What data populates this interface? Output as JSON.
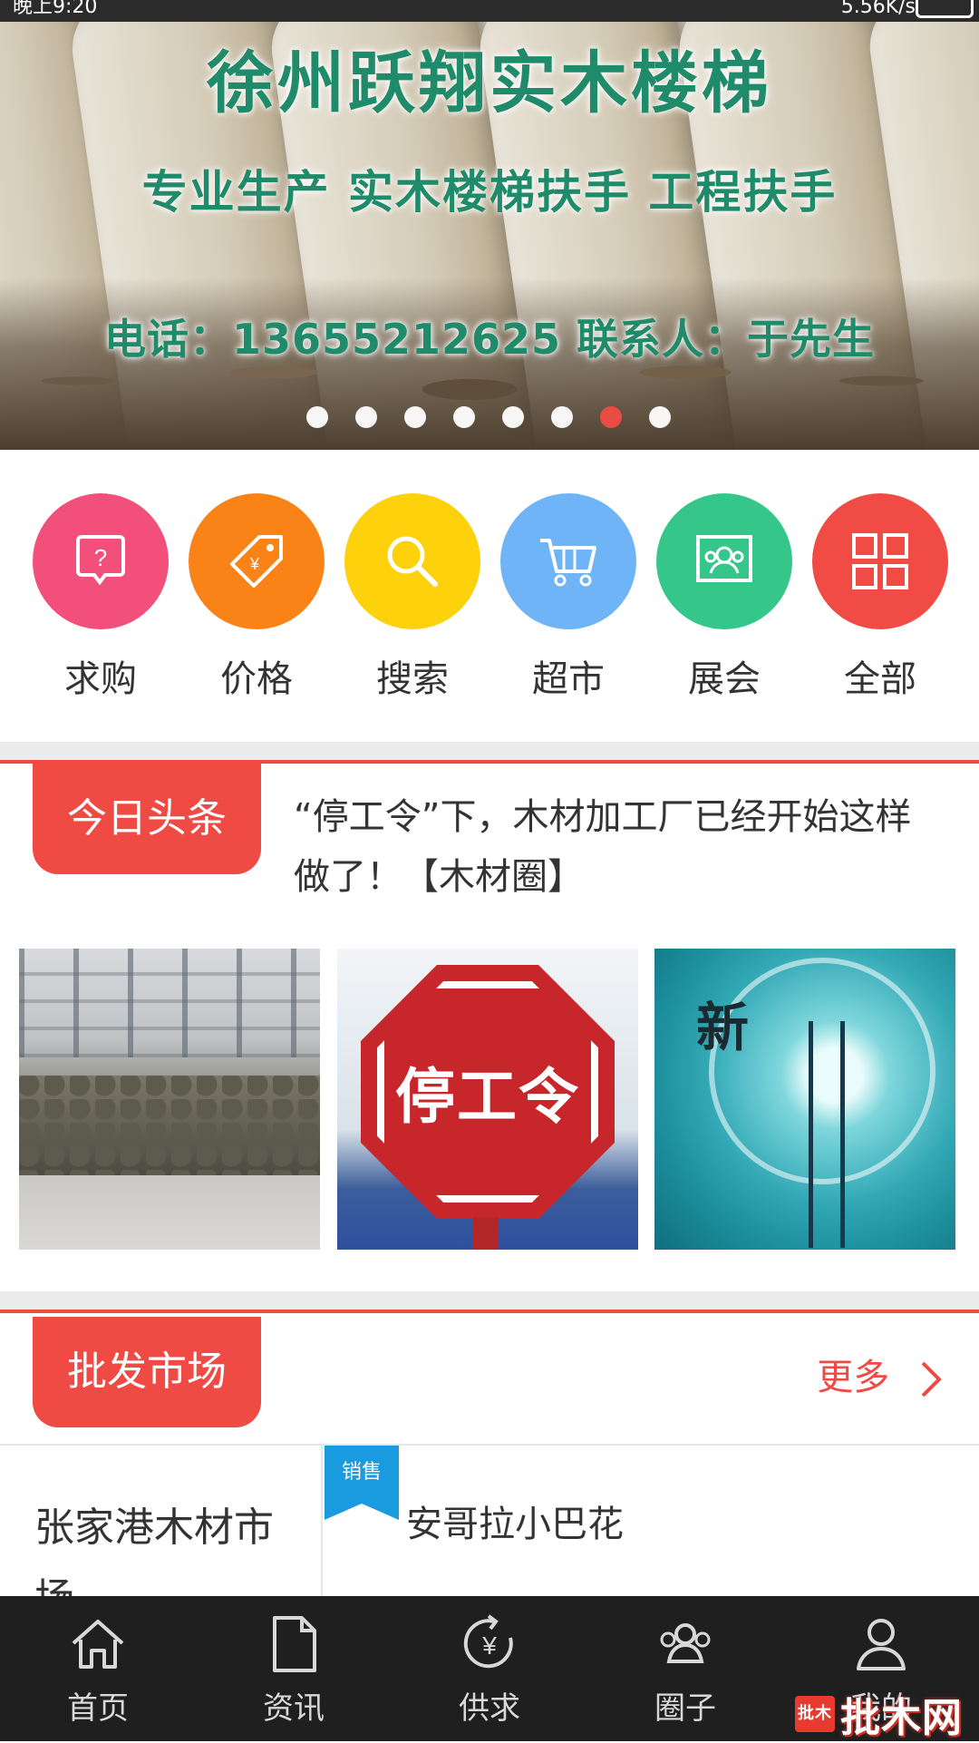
{
  "status_bar": {
    "time": "晚上9:20",
    "speed": "5.56K/s"
  },
  "banner": {
    "title": "徐州跃翔实木楼梯",
    "subtitle": "专业生产  实木楼梯扶手  工程扶手",
    "contact": "电话：13655212625  联系人：于先生",
    "carousel_total": 8,
    "carousel_active_index": 6
  },
  "categories": [
    {
      "label": "求购",
      "icon": "question-chat-icon",
      "color": "#f2507a"
    },
    {
      "label": "价格",
      "icon": "price-tag-icon",
      "color": "#f98317"
    },
    {
      "label": "搜索",
      "icon": "search-icon",
      "color": "#fdd10c"
    },
    {
      "label": "超市",
      "icon": "cart-icon",
      "color": "#6eb4f7"
    },
    {
      "label": "展会",
      "icon": "exhibition-icon",
      "color": "#35c78a"
    },
    {
      "label": "全部",
      "icon": "grid-icon",
      "color": "#f04b45"
    }
  ],
  "headlines": {
    "tag": "今日头条",
    "text": "“停工令”下，木材加工厂已经开始这样做了！【木材圈】",
    "thumb2_text": "停工令",
    "thumb3_text": "新"
  },
  "market": {
    "tag": "批发市场",
    "more": "更多",
    "left_name": "张家港木材市场",
    "ribbon": "销售",
    "item": "安哥拉小巴花"
  },
  "bottom_nav": [
    {
      "label": "首页",
      "icon": "home-icon"
    },
    {
      "label": "资讯",
      "icon": "document-icon"
    },
    {
      "label": "供求",
      "icon": "yuan-cycle-icon"
    },
    {
      "label": "圈子",
      "icon": "group-icon"
    },
    {
      "label": "我的",
      "icon": "user-icon"
    }
  ],
  "watermark": {
    "logo": "批木",
    "text": "批木网"
  },
  "colors": {
    "accent": "#ef4a43",
    "ribbon": "#1a9be0",
    "nav_bg": "#1f1f1f"
  }
}
